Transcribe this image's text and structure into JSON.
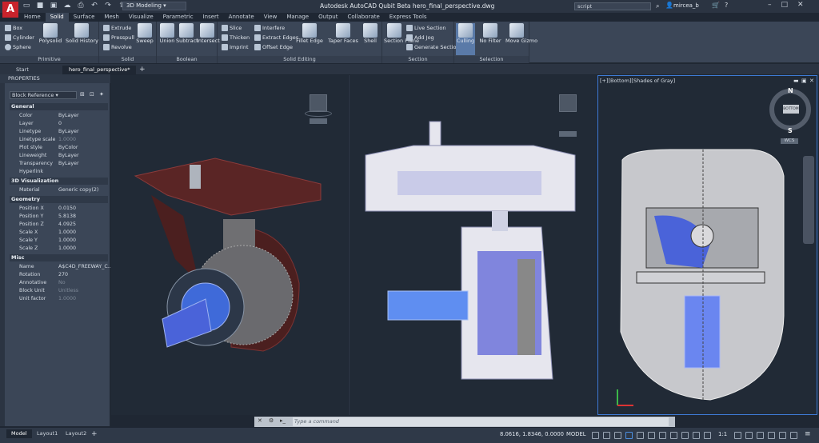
{
  "app": {
    "logo": "A",
    "title": "Autodesk AutoCAD Qubit Beta   hero_final_perspective.dwg",
    "workspace": "3D Modeling",
    "search_value": "script",
    "user": "mircea_b"
  },
  "ribbon_tabs": [
    "Home",
    "Solid",
    "Surface",
    "Mesh",
    "Visualize",
    "Parametric",
    "Insert",
    "Annotate",
    "View",
    "Manage",
    "Output",
    "Collaborate",
    "Express Tools"
  ],
  "ribbon_active_tab": "Solid",
  "ribbon": {
    "primitive": {
      "label": "Primitive",
      "box": "Box",
      "cylinder": "Cylinder",
      "sphere": "Sphere",
      "polysolid": "Polysolid"
    },
    "solid": {
      "label": "Solid",
      "solid_history": "Solid History",
      "extrude": "Extrude",
      "presspull": "Presspull",
      "revolve": "Revolve",
      "sweep": "Sweep"
    },
    "boolean": {
      "label": "Boolean",
      "union": "Union",
      "subtract": "Subtract",
      "intersect": "Intersect"
    },
    "solid_editing": {
      "label": "Solid Editing",
      "slice": "Slice",
      "thicken": "Thicken",
      "imprint": "Imprint",
      "interfere": "Interfere",
      "extract_edges": "Extract Edges",
      "offset_edge": "Offset Edge",
      "fillet_edge": "Fillet Edge",
      "taper_faces": "Taper Faces",
      "shell": "Shell"
    },
    "section": {
      "label": "Section",
      "section_plane": "Section Plane",
      "live_section": "Live Section",
      "add_jog": "Add Jog",
      "generate_section": "Generate Section"
    },
    "selection": {
      "label": "Selection",
      "culling": "Culling",
      "no_filter": "No Filter",
      "move_gizmo": "Move Gizmo"
    }
  },
  "doc_tabs": [
    "Start",
    "hero_final_perspective*"
  ],
  "properties": {
    "title": "PROPERTIES",
    "object": "Block Reference",
    "categories": [
      {
        "name": "General",
        "rows": [
          [
            "Color",
            "ByLayer"
          ],
          [
            "Layer",
            "0"
          ],
          [
            "Linetype",
            "ByLayer"
          ],
          [
            "Linetype scale",
            "1.0000"
          ],
          [
            "Plot style",
            "ByColor"
          ],
          [
            "Lineweight",
            "ByLayer"
          ],
          [
            "Transparency",
            "ByLayer"
          ],
          [
            "Hyperlink",
            ""
          ]
        ]
      },
      {
        "name": "3D Visualization",
        "rows": [
          [
            "Material",
            "Generic copy(2)"
          ]
        ]
      },
      {
        "name": "Geometry",
        "rows": [
          [
            "Position X",
            "0.0150"
          ],
          [
            "Position Y",
            "5.8138"
          ],
          [
            "Position Z",
            "4.0925"
          ],
          [
            "Scale X",
            "1.0000"
          ],
          [
            "Scale Y",
            "1.0000"
          ],
          [
            "Scale Z",
            "1.0000"
          ]
        ]
      },
      {
        "name": "Misc",
        "rows": [
          [
            "Name",
            "A$C4D_FREEWAY_C..."
          ],
          [
            "Rotation",
            "270"
          ],
          [
            "Annotative",
            "No"
          ],
          [
            "Block Unit",
            "Unitless"
          ],
          [
            "Unit factor",
            "1.0000"
          ]
        ]
      }
    ]
  },
  "viewport3": {
    "label": "[+][Bottom][Shades of Gray]",
    "compass_face": "BOTTOM",
    "north": "N",
    "south": "S",
    "wcs": "WCS"
  },
  "command_line": {
    "placeholder": "Type a command"
  },
  "status": {
    "layout_tabs": [
      "Model",
      "Layout1",
      "Layout2"
    ],
    "coords": "8.0616, 1.8346, 0.0000",
    "model": "MODEL",
    "scale": "1:1"
  },
  "colors": {
    "accent": "#3e7bd6",
    "part_red": "#5a2525",
    "part_blue": "#4a63d9"
  }
}
